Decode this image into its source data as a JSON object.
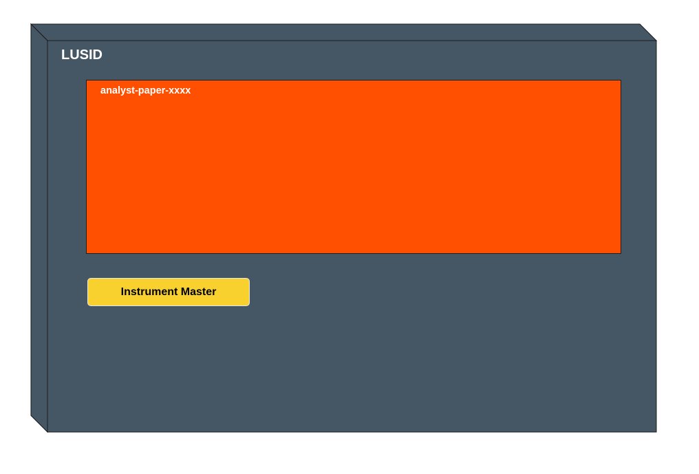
{
  "node": {
    "title": "LUSID",
    "front_color": "#455665",
    "side_color": "#455665",
    "border_color": "#1a1a1a"
  },
  "paper_box": {
    "label": "analyst-paper-xxxx",
    "fill_color": "#FF4F00"
  },
  "instrument_master": {
    "label": "Instrument Master",
    "fill_color": "#F8D12F"
  }
}
